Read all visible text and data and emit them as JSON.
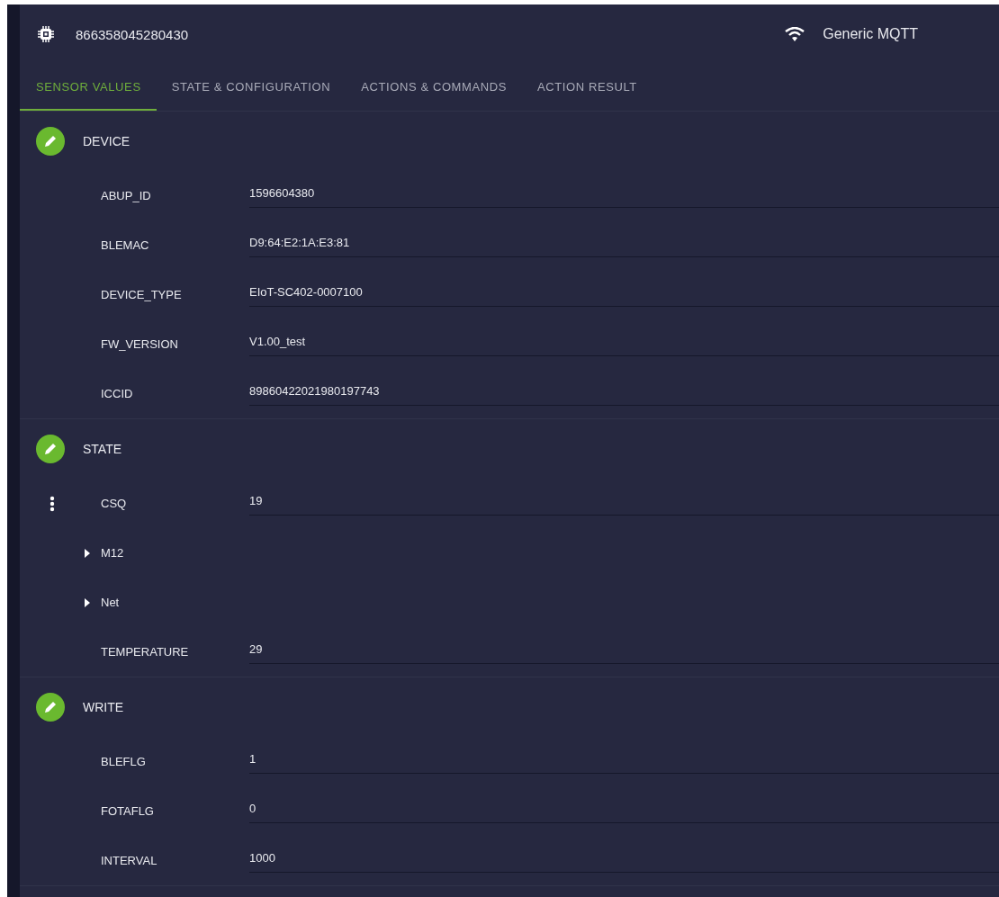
{
  "header": {
    "device_id": "866358045280430",
    "connection": "Generic MQTT"
  },
  "tabs": [
    {
      "label": "SENSOR VALUES",
      "selected": true
    },
    {
      "label": "STATE & CONFIGURATION",
      "selected": false
    },
    {
      "label": "ACTIONS & COMMANDS",
      "selected": false
    },
    {
      "label": "ACTION RESULT",
      "selected": false
    }
  ],
  "sections": [
    {
      "title": "DEVICE",
      "rows": [
        {
          "kind": "field",
          "label": "ABUP_ID",
          "value": "1596604380",
          "show_menu": false
        },
        {
          "kind": "field",
          "label": "BLEMAC",
          "value": "D9:64:E2:1A:E3:81",
          "show_menu": false
        },
        {
          "kind": "field",
          "label": "DEVICE_TYPE",
          "value": "EIoT-SC402-0007100",
          "show_menu": false
        },
        {
          "kind": "field",
          "label": "FW_VERSION",
          "value": "V1.00_test",
          "show_menu": false
        },
        {
          "kind": "field",
          "label": "ICCID",
          "value": "89860422021980197743",
          "show_menu": false
        }
      ]
    },
    {
      "title": "STATE",
      "rows": [
        {
          "kind": "field",
          "label": "CSQ",
          "value": "19",
          "show_menu": true
        },
        {
          "kind": "group",
          "label": "M12",
          "expanded": false,
          "show_menu": false
        },
        {
          "kind": "group",
          "label": "Net",
          "expanded": false,
          "show_menu": false
        },
        {
          "kind": "field",
          "label": "TEMPERATURE",
          "value": "29",
          "show_menu": false
        }
      ]
    },
    {
      "title": "WRITE",
      "rows": [
        {
          "kind": "field",
          "label": "BLEFLG",
          "value": "1",
          "show_menu": false
        },
        {
          "kind": "field",
          "label": "FOTAFLG",
          "value": "0",
          "show_menu": false
        },
        {
          "kind": "field",
          "label": "INTERVAL",
          "value": "1000",
          "show_menu": false
        }
      ]
    }
  ]
}
